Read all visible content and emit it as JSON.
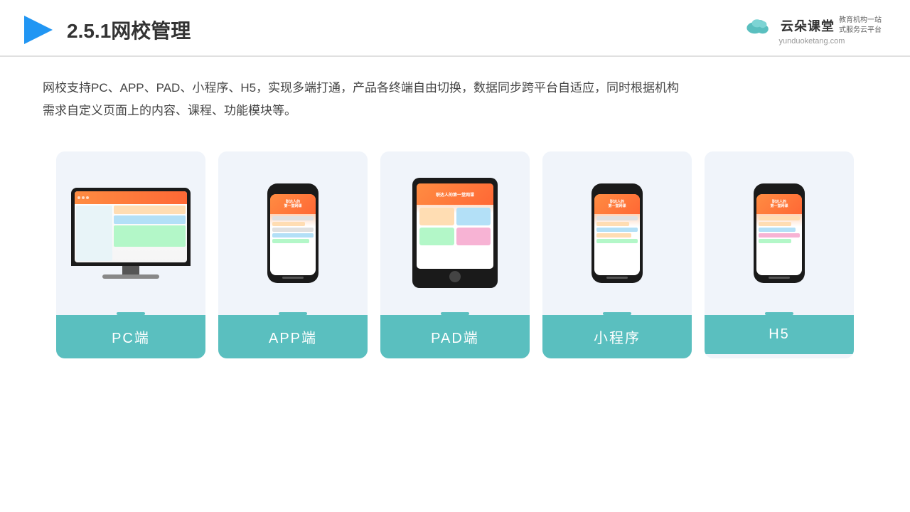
{
  "header": {
    "title": "2.5.1网校管理",
    "logo_name": "云朵课堂",
    "logo_tagline": "教育机构一站\n式服务云平台",
    "logo_url": "yunduoketang.com"
  },
  "description": "网校支持PC、APP、PAD、小程序、H5，实现多端打通，产品各终端自由切换，数据同步跨平台自适应，同时根据机构\n需求自定义页面上的内容、课程、功能模块等。",
  "cards": [
    {
      "id": "pc",
      "label": "PC端",
      "type": "pc"
    },
    {
      "id": "app",
      "label": "APP端",
      "type": "phone"
    },
    {
      "id": "pad",
      "label": "PAD端",
      "type": "tablet"
    },
    {
      "id": "miniapp",
      "label": "小程序",
      "type": "phone"
    },
    {
      "id": "h5",
      "label": "H5",
      "type": "phone"
    }
  ],
  "colors": {
    "teal": "#5abfbf",
    "header_line": "#e0e0e0",
    "card_bg": "#f0f4fa",
    "text_dark": "#333333",
    "text_body": "#444444"
  }
}
